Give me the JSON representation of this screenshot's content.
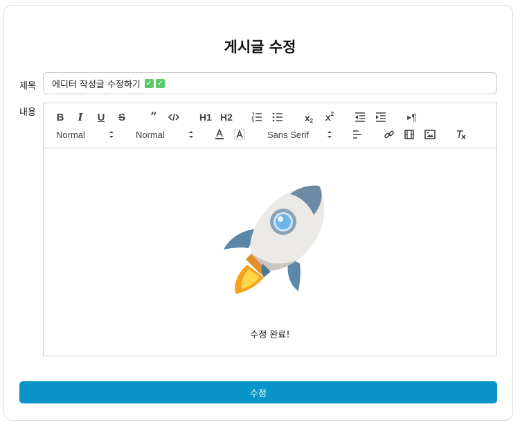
{
  "form": {
    "heading": "게시글 수정",
    "title_label": "제목",
    "content_label": "내용",
    "title_value": "에디터 작성글 수정하기",
    "submit_label": "수정"
  },
  "toolbar": {
    "header_picker": "Normal",
    "size_picker": "Normal",
    "font_picker": "Sans Serif",
    "h1": "H1",
    "h2": "H2"
  },
  "editor_content": {
    "image": "rocket-emoji",
    "caption": "수정 완료!"
  },
  "colors": {
    "accent": "#0a95c8",
    "check": "#5cc96b"
  }
}
